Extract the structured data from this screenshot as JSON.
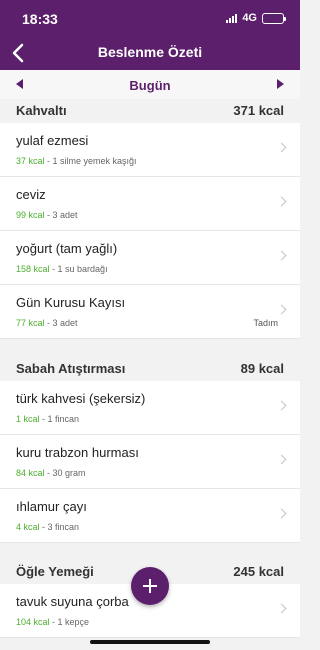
{
  "status_bar": {
    "time": "18:33",
    "network": "4G"
  },
  "header": {
    "title": "Beslenme Özeti"
  },
  "date_bar": {
    "label": "Bugün"
  },
  "sections": [
    {
      "name": "Kahvaltı",
      "kcal": "371 kcal",
      "items": [
        {
          "food": "yulaf ezmesi",
          "kcal": "37 kcal",
          "portion": " - 1 silme yemek kaşığı",
          "tag": ""
        },
        {
          "food": "ceviz",
          "kcal": "99 kcal",
          "portion": " - 3 adet",
          "tag": ""
        },
        {
          "food": "yoğurt (tam yağlı)",
          "kcal": "158 kcal",
          "portion": " - 1 su bardağı",
          "tag": ""
        },
        {
          "food": "Gün Kurusu Kayısı",
          "kcal": "77 kcal",
          "portion": " - 3 adet",
          "tag": "Tadım"
        }
      ]
    },
    {
      "name": "Sabah Atıştırması",
      "kcal": "89 kcal",
      "items": [
        {
          "food": "türk kahvesi (şekersiz)",
          "kcal": "1 kcal",
          "portion": " - 1 fincan",
          "tag": ""
        },
        {
          "food": "kuru trabzon hurması",
          "kcal": "84 kcal",
          "portion": " - 30 gram",
          "tag": ""
        },
        {
          "food": "ıhlamur çayı",
          "kcal": "4 kcal",
          "portion": " - 3 fincan",
          "tag": ""
        }
      ]
    },
    {
      "name": "Öğle Yemeği",
      "kcal": "245 kcal",
      "items": [
        {
          "food": "tavuk suyuna çorba",
          "kcal": "104 kcal",
          "portion": " - 1 kepçe",
          "tag": ""
        }
      ]
    }
  ],
  "colors": {
    "accent": "#5c1f6b",
    "kcal_green": "#4caf2f",
    "background": "#f2f2f2"
  },
  "icons": {
    "back": "chevron-left-icon",
    "prev": "triangle-left-icon",
    "next": "triangle-right-icon",
    "add": "plus-icon",
    "row": "chevron-right-icon"
  }
}
